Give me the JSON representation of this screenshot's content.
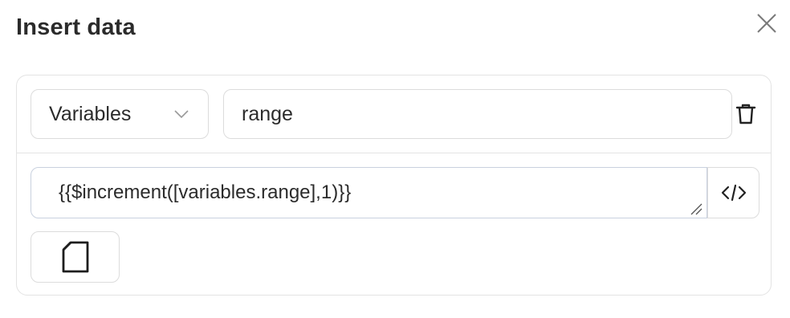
{
  "dialog": {
    "title": "Insert data"
  },
  "row": {
    "type_select": {
      "selected": "Variables"
    },
    "name_input": {
      "value": "range"
    },
    "expression": {
      "value": "{{$increment([variables.range],1)}}"
    }
  },
  "icons": {
    "close": "close-icon",
    "chevron": "chevron-down-icon",
    "delete": "trash-icon",
    "code": "code-icon",
    "document": "document-icon",
    "resize": "resize-handle-icon"
  }
}
